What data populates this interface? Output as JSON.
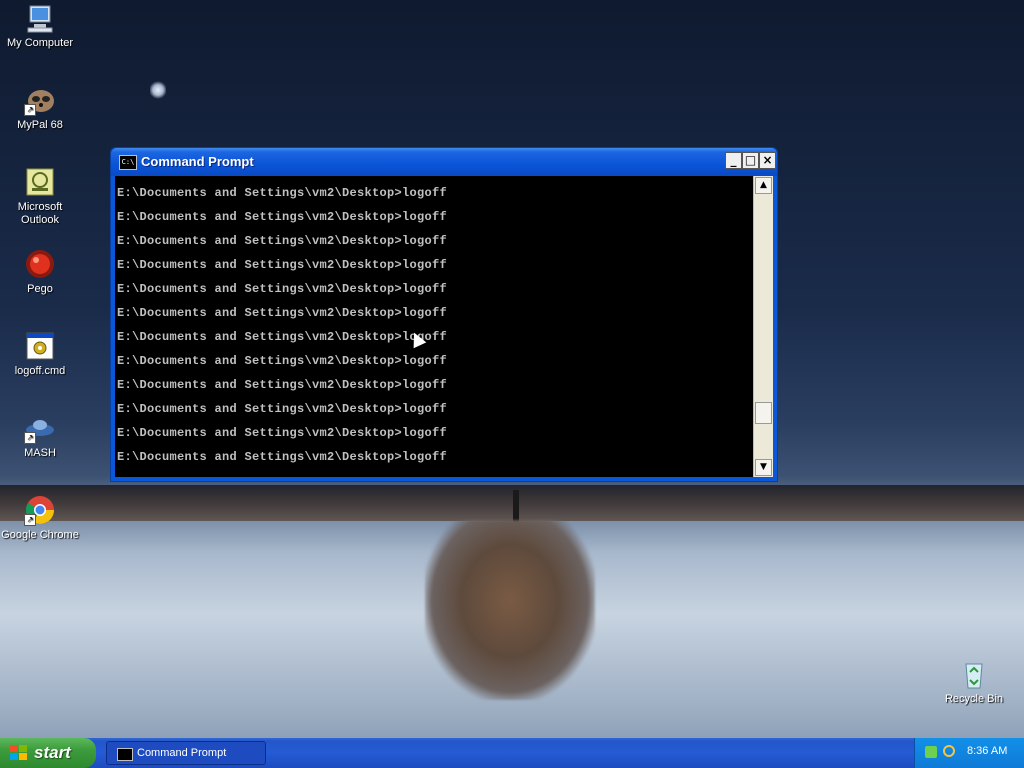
{
  "desktop": {
    "icons": [
      {
        "label": "My Computer",
        "icon": "computer-icon"
      },
      {
        "label": "MyPal 68",
        "icon": "raccoon-icon"
      },
      {
        "label": "Microsoft Outlook",
        "icon": "outlook-icon"
      },
      {
        "label": "Pego",
        "icon": "pego-icon"
      },
      {
        "label": "logoff.cmd",
        "icon": "cmd-file-icon"
      },
      {
        "label": "MASH",
        "icon": "mash-icon"
      },
      {
        "label": "Google Chrome",
        "icon": "chrome-icon"
      },
      {
        "label": "Recycle Bin",
        "icon": "recycle-bin-icon"
      }
    ]
  },
  "window": {
    "title": "Command Prompt",
    "icon": "cmd-icon",
    "controls": {
      "minimize": "_",
      "maximize": "□",
      "close": "×"
    },
    "lines": [
      "E:\\Documents and Settings\\vm2\\Desktop>logoff",
      "E:\\Documents and Settings\\vm2\\Desktop>logoff",
      "E:\\Documents and Settings\\vm2\\Desktop>logoff",
      "E:\\Documents and Settings\\vm2\\Desktop>logoff",
      "E:\\Documents and Settings\\vm2\\Desktop>logoff",
      "E:\\Documents and Settings\\vm2\\Desktop>logoff",
      "E:\\Documents and Settings\\vm2\\Desktop>logoff",
      "E:\\Documents and Settings\\vm2\\Desktop>logoff",
      "E:\\Documents and Settings\\vm2\\Desktop>logoff",
      "E:\\Documents and Settings\\vm2\\Desktop>logoff",
      "E:\\Documents and Settings\\vm2\\Desktop>logoff",
      "E:\\Documents and Settings\\vm2\\Desktop>logoff"
    ]
  },
  "taskbar": {
    "start_label": "start",
    "task_label": "Command Prompt",
    "clock": "8:36 AM"
  }
}
